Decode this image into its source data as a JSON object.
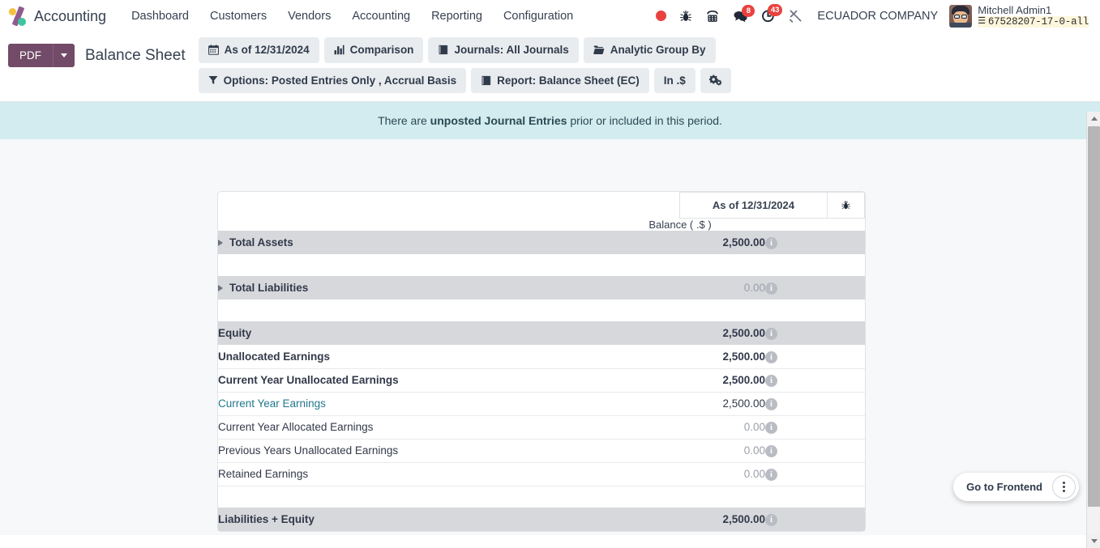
{
  "navbar": {
    "brand": "Accounting",
    "logo_icon": "odoo-accounting-logo-icon",
    "menu": [
      {
        "label": "Dashboard"
      },
      {
        "label": "Customers"
      },
      {
        "label": "Vendors"
      },
      {
        "label": "Accounting"
      },
      {
        "label": "Reporting"
      },
      {
        "label": "Configuration"
      }
    ],
    "tray": [
      {
        "name": "recording-indicator-icon",
        "icon": "record-dot",
        "badge": null
      },
      {
        "name": "bug-icon",
        "icon": "🐞",
        "badge": null
      },
      {
        "name": "phone-dialpad-icon",
        "icon": "phone",
        "badge": null
      },
      {
        "name": "messages-icon",
        "icon": "chat-bubble",
        "badge": "8"
      },
      {
        "name": "activities-icon",
        "icon": "clock",
        "badge": "43"
      },
      {
        "name": "developer-tools-icon",
        "icon": "wrench-screwdriver",
        "badge": null
      }
    ],
    "company": "ECUADOR COMPANY",
    "user": {
      "name": "Mitchell Admin1",
      "database": "67528207-17-0-all",
      "db_icon": "database-icon",
      "avatar": "user-avatar"
    }
  },
  "control_panel": {
    "pdf_label": "PDF",
    "pdf_dropdown_icon": "chevron-down-icon",
    "title": "Balance Sheet",
    "filters": [
      {
        "name": "date-filter",
        "icon": "calendar-icon",
        "label": "As of 12/31/2024"
      },
      {
        "name": "comparison-filter",
        "icon": "bar-chart-icon",
        "label": "Comparison"
      },
      {
        "name": "journals-filter",
        "icon": "book-icon",
        "label": "Journals: All Journals"
      },
      {
        "name": "analytic-group-by-filter",
        "icon": "folder-icon",
        "label": "Analytic Group By"
      },
      {
        "name": "options-filter",
        "icon": "filter-icon",
        "label": "Options: Posted Entries Only , Accrual Basis"
      },
      {
        "name": "report-variant-filter",
        "icon": "book-icon",
        "label": "Report: Balance Sheet (EC)"
      },
      {
        "name": "currency-filter",
        "icon": "none",
        "label": "In .$"
      },
      {
        "name": "settings-filter",
        "icon": "cogs-icon",
        "label": ""
      }
    ]
  },
  "banner": {
    "text_before": "There are ",
    "text_bold": "unposted Journal Entries",
    "text_after": " prior or included in this period."
  },
  "report": {
    "column_header": {
      "date_label": "As of 12/31/2024",
      "audit_icon": "bug-icon"
    },
    "balance_label": "Balance ( .$ )",
    "info_icon": "info-icon",
    "rows": [
      {
        "type": "data",
        "label": "Total Assets",
        "value": "2,500.00",
        "indent": 0,
        "bold_label": true,
        "bold_value": true,
        "muted_value": false,
        "shaded": true,
        "bordered": false,
        "expandable": true,
        "link": false
      },
      {
        "type": "spacer"
      },
      {
        "type": "data",
        "label": "Total Liabilities",
        "value": "0.00",
        "indent": 0,
        "bold_label": true,
        "bold_value": false,
        "muted_value": true,
        "shaded": true,
        "bordered": false,
        "expandable": true,
        "link": false
      },
      {
        "type": "spacer"
      },
      {
        "type": "data",
        "label": "Equity",
        "value": "2,500.00",
        "indent": 0,
        "bold_label": true,
        "bold_value": true,
        "muted_value": false,
        "shaded": true,
        "bordered": false,
        "expandable": false,
        "link": false
      },
      {
        "type": "data",
        "label": "Unallocated Earnings",
        "value": "2,500.00",
        "indent": 1,
        "bold_label": true,
        "bold_value": true,
        "muted_value": false,
        "shaded": false,
        "bordered": true,
        "expandable": false,
        "link": false
      },
      {
        "type": "data",
        "label": "Current Year Unallocated Earnings",
        "value": "2,500.00",
        "indent": 2,
        "bold_label": true,
        "bold_value": true,
        "muted_value": false,
        "shaded": false,
        "bordered": true,
        "expandable": false,
        "link": false
      },
      {
        "type": "data",
        "label": "Current Year Earnings",
        "value": "2,500.00",
        "indent": 3,
        "bold_label": false,
        "bold_value": false,
        "muted_value": false,
        "shaded": false,
        "bordered": true,
        "expandable": false,
        "link": true
      },
      {
        "type": "data",
        "label": "Current Year Allocated Earnings",
        "value": "0.00",
        "indent": 3,
        "bold_label": false,
        "bold_value": false,
        "muted_value": true,
        "shaded": false,
        "bordered": true,
        "expandable": false,
        "link": false
      },
      {
        "type": "data",
        "label": "Previous Years Unallocated Earnings",
        "value": "0.00",
        "indent": 2,
        "bold_label": false,
        "bold_value": false,
        "muted_value": true,
        "shaded": false,
        "bordered": true,
        "expandable": false,
        "link": false
      },
      {
        "type": "data",
        "label": "Retained Earnings",
        "value": "0.00",
        "indent": 1,
        "bold_label": false,
        "bold_value": false,
        "muted_value": true,
        "shaded": false,
        "bordered": true,
        "expandable": false,
        "link": false
      },
      {
        "type": "spacer"
      },
      {
        "type": "data",
        "label": "Liabilities + Equity",
        "value": "2,500.00",
        "indent": 0,
        "bold_label": true,
        "bold_value": true,
        "muted_value": false,
        "shaded": true,
        "bordered": false,
        "expandable": false,
        "link": false
      }
    ]
  },
  "frontend_widget": {
    "label": "Go to Frontend",
    "more_icon": "kebab-menu-icon"
  },
  "colors": {
    "brand_purple": "#714b67",
    "banner_bg": "#d2ecf0",
    "row_shaded": "#d6d8dc",
    "link_teal": "#22798c",
    "badge_red": "#e8423f"
  }
}
